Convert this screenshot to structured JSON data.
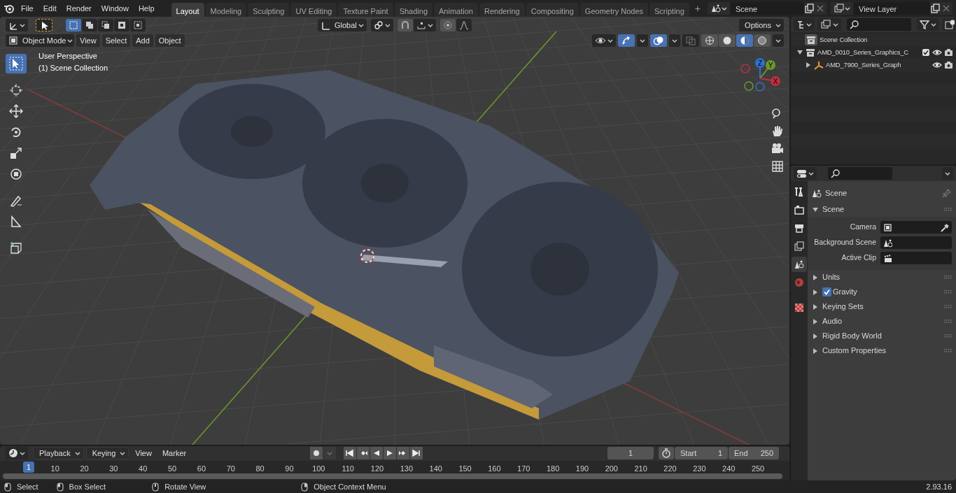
{
  "top_menu": [
    "File",
    "Edit",
    "Render",
    "Window",
    "Help"
  ],
  "workspace_tabs": [
    {
      "label": "Layout",
      "selected": true
    },
    {
      "label": "Modeling",
      "selected": false
    },
    {
      "label": "Sculpting",
      "selected": false
    },
    {
      "label": "UV Editing",
      "selected": false
    },
    {
      "label": "Texture Paint",
      "selected": false
    },
    {
      "label": "Shading",
      "selected": false
    },
    {
      "label": "Animation",
      "selected": false
    },
    {
      "label": "Rendering",
      "selected": false
    },
    {
      "label": "Compositing",
      "selected": false
    },
    {
      "label": "Geometry Nodes",
      "selected": false
    },
    {
      "label": "Scripting",
      "selected": false
    }
  ],
  "add_tab_label": "+",
  "scene_selector": {
    "value": "Scene"
  },
  "view_layer_selector": {
    "value": "View Layer"
  },
  "viewport": {
    "select_modes": [
      {
        "selected": true
      },
      {
        "selected": false
      },
      {
        "selected": false
      },
      {
        "selected": false
      },
      {
        "selected": false
      }
    ],
    "transform_orientation": "Global",
    "options_label": "Options",
    "mode": "Object Mode",
    "menus": [
      "View",
      "Select",
      "Add",
      "Object"
    ],
    "show_gizmos": true,
    "show_overlays": true,
    "shading_modes": [
      {
        "selected": false
      },
      {
        "selected": false
      },
      {
        "selected": true
      },
      {
        "selected": false
      }
    ],
    "tools": [
      {
        "selected": true
      },
      {
        "selected": false
      },
      {
        "selected": false
      },
      {
        "selected": false
      },
      {
        "selected": false
      },
      {
        "selected": false
      },
      {
        "selected": false
      },
      {
        "selected": false
      },
      {
        "selected": false
      }
    ],
    "info_lines": [
      "User Perspective",
      "(1) Scene Collection"
    ],
    "gizmo_axes": [
      "Z",
      "Y",
      "X"
    ]
  },
  "outliner": {
    "root": "Scene Collection",
    "items": [
      {
        "label": "AMD_0010_Series_Graphics_C",
        "kind": "collection",
        "expanded": true,
        "checked": true,
        "children": [
          {
            "label": "AMD_7900_Series_Graph",
            "kind": "object",
            "expanded": false
          }
        ]
      }
    ]
  },
  "properties": {
    "tabs": [
      {
        "selected": false
      },
      {
        "selected": false
      },
      {
        "selected": false
      },
      {
        "selected": false
      },
      {
        "selected": true
      },
      {
        "selected": false
      },
      {
        "selected": false
      }
    ],
    "context": "Scene",
    "panels": [
      {
        "title": "Scene",
        "kind": "plain",
        "expanded": true,
        "fields": [
          "Camera",
          "Background Scene",
          "Active Clip"
        ]
      },
      {
        "title": "Units",
        "kind": "plain",
        "expanded": false
      },
      {
        "title": "Gravity",
        "kind": "checkbox",
        "expanded": false,
        "checked": true
      },
      {
        "title": "Keying Sets",
        "kind": "plain",
        "expanded": false
      },
      {
        "title": "Audio",
        "kind": "plain",
        "expanded": false
      },
      {
        "title": "Rigid Body World",
        "kind": "plain",
        "expanded": false
      },
      {
        "title": "Custom Properties",
        "kind": "plain",
        "expanded": false
      }
    ]
  },
  "timeline": {
    "menus": [
      "Playback",
      "Keying",
      "View",
      "Marker"
    ],
    "current_frame": "1",
    "start_label": "Start",
    "start": "1",
    "end_label": "End",
    "end": "250",
    "playhead_label": "1",
    "ruler": [
      "10",
      "20",
      "30",
      "40",
      "50",
      "60",
      "70",
      "80",
      "90",
      "100",
      "110",
      "120",
      "130",
      "140",
      "150",
      "160",
      "170",
      "180",
      "190",
      "200",
      "210",
      "220",
      "230",
      "240",
      "250"
    ]
  },
  "status_bar": {
    "hints": [
      "Select",
      "Box Select",
      "Rotate View",
      "Object Context Menu"
    ],
    "version": "2.93.16"
  }
}
